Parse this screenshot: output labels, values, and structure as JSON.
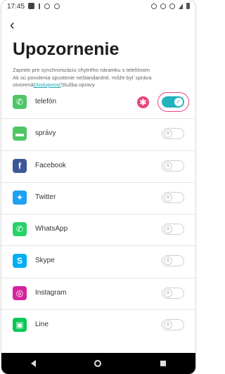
{
  "status_bar": {
    "time": "17:45"
  },
  "header": {
    "title": "Upozornenie",
    "description_line1": "Zapnite pre synchronizáciu chytrého náramku s telefónom",
    "description_line2": "Ak sú povolenia spustenie neštandardné, môže byť správa",
    "description_line3_prefix": "otvorená",
    "description_link": "Dostupnosť",
    "description_line3_suffix": "Služba opravy"
  },
  "apps": [
    {
      "label": "telefón",
      "enabled": true,
      "icon": "phone-icon",
      "color": "#4cc764"
    },
    {
      "label": "správy",
      "enabled": false,
      "icon": "message-icon",
      "color": "#4cc764"
    },
    {
      "label": "Facebook",
      "enabled": false,
      "icon": "facebook-icon",
      "color": "#3b5998"
    },
    {
      "label": "Twitter",
      "enabled": false,
      "icon": "twitter-icon",
      "color": "#1da1f2"
    },
    {
      "label": "WhatsApp",
      "enabled": false,
      "icon": "whatsapp-icon",
      "color": "#25d366"
    },
    {
      "label": "Skype",
      "enabled": false,
      "icon": "skype-icon",
      "color": "#00aff0"
    },
    {
      "label": "Instagram",
      "enabled": false,
      "icon": "instagram-icon",
      "color": "#d6249f"
    },
    {
      "label": "Line",
      "enabled": false,
      "icon": "line-icon",
      "color": "#06c755"
    }
  ],
  "toggle_glyphs": {
    "on": "✓",
    "off": "×"
  },
  "accent_color": "#22b3bf",
  "marker_color": "#e6447f",
  "marker_glyph": "✱"
}
